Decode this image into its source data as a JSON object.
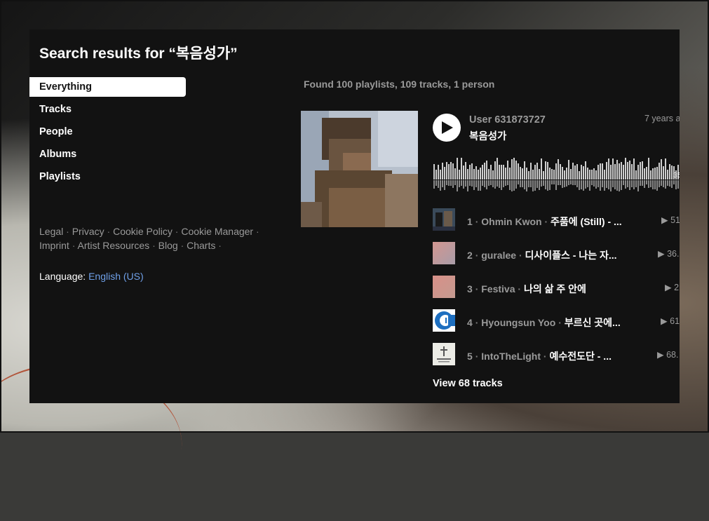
{
  "page": {
    "title": "Search results for “복음성가”",
    "found_summary": "Found 100 playlists, 109 tracks, 1 person"
  },
  "nav": {
    "items": [
      {
        "label": "Everything",
        "active": true
      },
      {
        "label": "Tracks",
        "active": false
      },
      {
        "label": "People",
        "active": false
      },
      {
        "label": "Albums",
        "active": false
      },
      {
        "label": "Playlists",
        "active": false
      }
    ]
  },
  "footer": {
    "links": [
      "Legal",
      "Privacy",
      "Cookie Policy",
      "Cookie Manager",
      "Imprint",
      "Artist Resources",
      "Blog",
      "Charts"
    ],
    "separator": "·",
    "language_label": "Language:",
    "language_value": "English (US)"
  },
  "playlist": {
    "uploader": "User 631873727",
    "title": "복음성가",
    "age": "7 years a",
    "waveform_count": "35",
    "view_all_label": "View 68 tracks",
    "tracks": [
      {
        "number": "1",
        "artist": "Ohmin Kwon",
        "title": "주품에 (Still) - ...",
        "plays": "51",
        "thumb_color": "#3a4a5a"
      },
      {
        "number": "2",
        "artist": "guralee",
        "title": "디사이플스 - 나는 자...",
        "plays": "36.",
        "thumb_color": "#c89a94"
      },
      {
        "number": "3",
        "artist": "Festiva",
        "title": "나의 삶 주 안에",
        "plays": "2",
        "thumb_color": "#d0948a"
      },
      {
        "number": "4",
        "artist": "Hyoungsun Yoo",
        "title": "부르신 곳에...",
        "plays": "61",
        "thumb_color": "#1e6fc0"
      },
      {
        "number": "5",
        "artist": "IntoTheLight",
        "title": "예수전도단 - ...",
        "plays": "68.",
        "thumb_color": "#e8e8e2"
      }
    ]
  },
  "icons": {
    "play": "play-icon",
    "small_play": "play-count-icon"
  },
  "colors": {
    "panel_bg": "#121212",
    "link_blue": "#6fa0e8",
    "muted_text": "#9a9a9a"
  }
}
